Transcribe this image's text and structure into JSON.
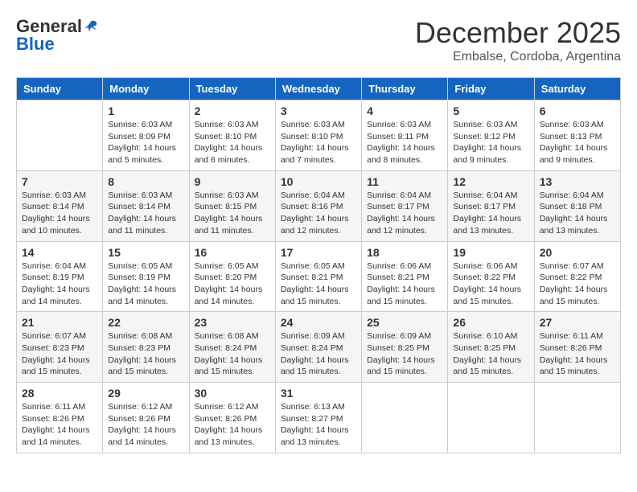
{
  "header": {
    "logo_general": "General",
    "logo_blue": "Blue",
    "month_title": "December 2025",
    "location": "Embalse, Cordoba, Argentina"
  },
  "weekdays": [
    "Sunday",
    "Monday",
    "Tuesday",
    "Wednesday",
    "Thursday",
    "Friday",
    "Saturday"
  ],
  "weeks": [
    [
      {
        "day": "",
        "info": ""
      },
      {
        "day": "1",
        "info": "Sunrise: 6:03 AM\nSunset: 8:09 PM\nDaylight: 14 hours\nand 5 minutes."
      },
      {
        "day": "2",
        "info": "Sunrise: 6:03 AM\nSunset: 8:10 PM\nDaylight: 14 hours\nand 6 minutes."
      },
      {
        "day": "3",
        "info": "Sunrise: 6:03 AM\nSunset: 8:10 PM\nDaylight: 14 hours\nand 7 minutes."
      },
      {
        "day": "4",
        "info": "Sunrise: 6:03 AM\nSunset: 8:11 PM\nDaylight: 14 hours\nand 8 minutes."
      },
      {
        "day": "5",
        "info": "Sunrise: 6:03 AM\nSunset: 8:12 PM\nDaylight: 14 hours\nand 9 minutes."
      },
      {
        "day": "6",
        "info": "Sunrise: 6:03 AM\nSunset: 8:13 PM\nDaylight: 14 hours\nand 9 minutes."
      }
    ],
    [
      {
        "day": "7",
        "info": "Sunrise: 6:03 AM\nSunset: 8:14 PM\nDaylight: 14 hours\nand 10 minutes."
      },
      {
        "day": "8",
        "info": "Sunrise: 6:03 AM\nSunset: 8:14 PM\nDaylight: 14 hours\nand 11 minutes."
      },
      {
        "day": "9",
        "info": "Sunrise: 6:03 AM\nSunset: 8:15 PM\nDaylight: 14 hours\nand 11 minutes."
      },
      {
        "day": "10",
        "info": "Sunrise: 6:04 AM\nSunset: 8:16 PM\nDaylight: 14 hours\nand 12 minutes."
      },
      {
        "day": "11",
        "info": "Sunrise: 6:04 AM\nSunset: 8:17 PM\nDaylight: 14 hours\nand 12 minutes."
      },
      {
        "day": "12",
        "info": "Sunrise: 6:04 AM\nSunset: 8:17 PM\nDaylight: 14 hours\nand 13 minutes."
      },
      {
        "day": "13",
        "info": "Sunrise: 6:04 AM\nSunset: 8:18 PM\nDaylight: 14 hours\nand 13 minutes."
      }
    ],
    [
      {
        "day": "14",
        "info": "Sunrise: 6:04 AM\nSunset: 8:19 PM\nDaylight: 14 hours\nand 14 minutes."
      },
      {
        "day": "15",
        "info": "Sunrise: 6:05 AM\nSunset: 8:19 PM\nDaylight: 14 hours\nand 14 minutes."
      },
      {
        "day": "16",
        "info": "Sunrise: 6:05 AM\nSunset: 8:20 PM\nDaylight: 14 hours\nand 14 minutes."
      },
      {
        "day": "17",
        "info": "Sunrise: 6:05 AM\nSunset: 8:21 PM\nDaylight: 14 hours\nand 15 minutes."
      },
      {
        "day": "18",
        "info": "Sunrise: 6:06 AM\nSunset: 8:21 PM\nDaylight: 14 hours\nand 15 minutes."
      },
      {
        "day": "19",
        "info": "Sunrise: 6:06 AM\nSunset: 8:22 PM\nDaylight: 14 hours\nand 15 minutes."
      },
      {
        "day": "20",
        "info": "Sunrise: 6:07 AM\nSunset: 8:22 PM\nDaylight: 14 hours\nand 15 minutes."
      }
    ],
    [
      {
        "day": "21",
        "info": "Sunrise: 6:07 AM\nSunset: 8:23 PM\nDaylight: 14 hours\nand 15 minutes."
      },
      {
        "day": "22",
        "info": "Sunrise: 6:08 AM\nSunset: 8:23 PM\nDaylight: 14 hours\nand 15 minutes."
      },
      {
        "day": "23",
        "info": "Sunrise: 6:08 AM\nSunset: 8:24 PM\nDaylight: 14 hours\nand 15 minutes."
      },
      {
        "day": "24",
        "info": "Sunrise: 6:09 AM\nSunset: 8:24 PM\nDaylight: 14 hours\nand 15 minutes."
      },
      {
        "day": "25",
        "info": "Sunrise: 6:09 AM\nSunset: 8:25 PM\nDaylight: 14 hours\nand 15 minutes."
      },
      {
        "day": "26",
        "info": "Sunrise: 6:10 AM\nSunset: 8:25 PM\nDaylight: 14 hours\nand 15 minutes."
      },
      {
        "day": "27",
        "info": "Sunrise: 6:11 AM\nSunset: 8:26 PM\nDaylight: 14 hours\nand 15 minutes."
      }
    ],
    [
      {
        "day": "28",
        "info": "Sunrise: 6:11 AM\nSunset: 8:26 PM\nDaylight: 14 hours\nand 14 minutes."
      },
      {
        "day": "29",
        "info": "Sunrise: 6:12 AM\nSunset: 8:26 PM\nDaylight: 14 hours\nand 14 minutes."
      },
      {
        "day": "30",
        "info": "Sunrise: 6:12 AM\nSunset: 8:26 PM\nDaylight: 14 hours\nand 13 minutes."
      },
      {
        "day": "31",
        "info": "Sunrise: 6:13 AM\nSunset: 8:27 PM\nDaylight: 14 hours\nand 13 minutes."
      },
      {
        "day": "",
        "info": ""
      },
      {
        "day": "",
        "info": ""
      },
      {
        "day": "",
        "info": ""
      }
    ]
  ]
}
